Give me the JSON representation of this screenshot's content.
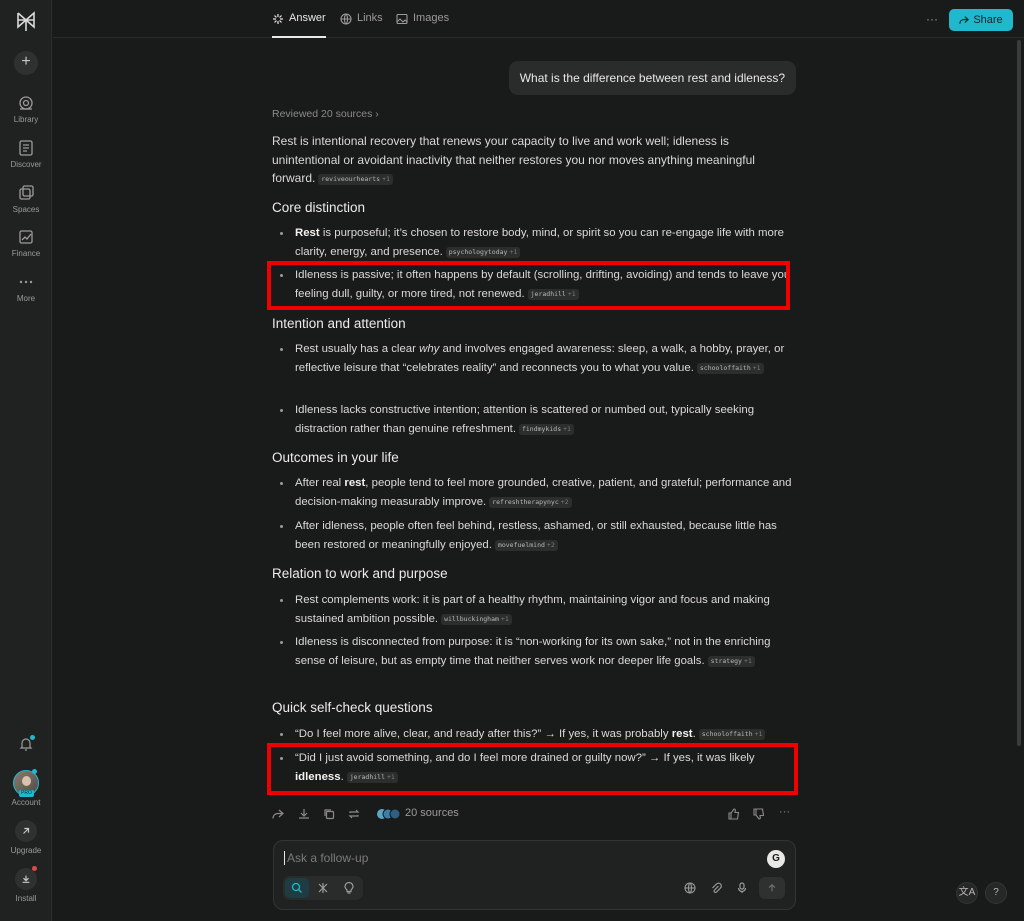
{
  "sidebar": {
    "new_label": "+",
    "items": [
      {
        "label": "Library",
        "icon": "library-icon"
      },
      {
        "label": "Discover",
        "icon": "discover-icon"
      },
      {
        "label": "Spaces",
        "icon": "spaces-icon"
      },
      {
        "label": "Finance",
        "icon": "finance-icon"
      },
      {
        "label": "More",
        "icon": "more-icon"
      }
    ],
    "account_label": "Account",
    "pro_badge": "PRO",
    "upgrade_label": "Upgrade",
    "install_label": "Install"
  },
  "topbar": {
    "tabs": [
      {
        "label": "Answer",
        "active": true
      },
      {
        "label": "Links",
        "active": false
      },
      {
        "label": "Images",
        "active": false
      }
    ],
    "more_label": "···",
    "share_label": "Share"
  },
  "question": "What is the difference between rest and idleness?",
  "reviewed": "Reviewed 20 sources ›",
  "intro": {
    "text": "Rest is intentional recovery that renews your capacity to live and work well; idleness is unintentional or avoidant inactivity that neither restores you nor moves anything meaningful forward.",
    "cite": "reviveourhearts",
    "cite_count": "+1"
  },
  "sections": [
    {
      "heading": "Core distinction",
      "items": [
        {
          "bold": "Rest",
          "text": " is purposeful; it’s chosen to restore body, mind, or spirit so you can re-engage life with more clarity, energy, and presence.",
          "cite": "psychologytoday",
          "count": "+1"
        },
        {
          "text": "Idleness is passive; it often happens by default (scrolling, drifting, avoiding) and tends to leave you feeling dull, guilty, or more tired, not renewed.",
          "cite": "jeradhill",
          "count": "+1"
        }
      ]
    },
    {
      "heading": "Intention and attention",
      "items": [
        {
          "pre": "Rest usually has a clear ",
          "italic": "why",
          "text": " and involves engaged awareness: sleep, a walk, a hobby, prayer, or reflective leisure that “celebrates reality” and reconnects you to what you value.",
          "cite": "schooloffaith",
          "count": "+1"
        },
        {
          "text": "Idleness lacks constructive intention; attention is scattered or numbed out, typically seeking distraction rather than genuine refreshment.",
          "cite": "findmykids",
          "count": "+1"
        }
      ]
    },
    {
      "heading": "Outcomes in your life",
      "items": [
        {
          "pre": "After real ",
          "bold": "rest",
          "text": ", people tend to feel more grounded, creative, patient, and grateful; performance and decision-making measurably improve.",
          "cite": "refreshtherapynyc",
          "count": "+2"
        },
        {
          "text": "After idleness, people often feel behind, restless, ashamed, or still exhausted, because little has been restored or meaningfully enjoyed.",
          "cite": "movefuelmind",
          "count": "+2"
        }
      ]
    },
    {
      "heading": "Relation to work and purpose",
      "items": [
        {
          "text": "Rest complements work: it is part of a healthy rhythm, maintaining vigor and focus and making sustained ambition possible.",
          "cite": "willbuckingham",
          "count": "+1"
        },
        {
          "text": "Idleness is disconnected from purpose: it is “non-working for its own sake,” not in the enriching sense of leisure, but as empty time that neither serves work nor deeper life goals.",
          "cite": "strategy",
          "count": "+1"
        }
      ]
    },
    {
      "heading": "Quick self-check questions",
      "items": [
        {
          "text": "“Do I feel more alive, clear, and ready after this?” → If yes, it was probably ",
          "bold": "rest",
          "post": ".",
          "cite": "schooloffaith",
          "count": "+1"
        },
        {
          "text": "“Did I just avoid something, and do I feel more drained or guilty now?” → If yes, it was likely ",
          "bold": "idleness",
          "post": ".",
          "cite": "jeradhill",
          "count": "+1"
        }
      ]
    }
  ],
  "actions": {
    "sources_label": "20 sources",
    "more_label": "···"
  },
  "followup": {
    "placeholder": "Ask a follow-up",
    "grammarly": "G"
  },
  "bottom_right": {
    "translate": "文A",
    "help": "?"
  },
  "colors": {
    "accent": "#20b8cd",
    "highlight": "#f00000",
    "background": "#191a1a"
  }
}
